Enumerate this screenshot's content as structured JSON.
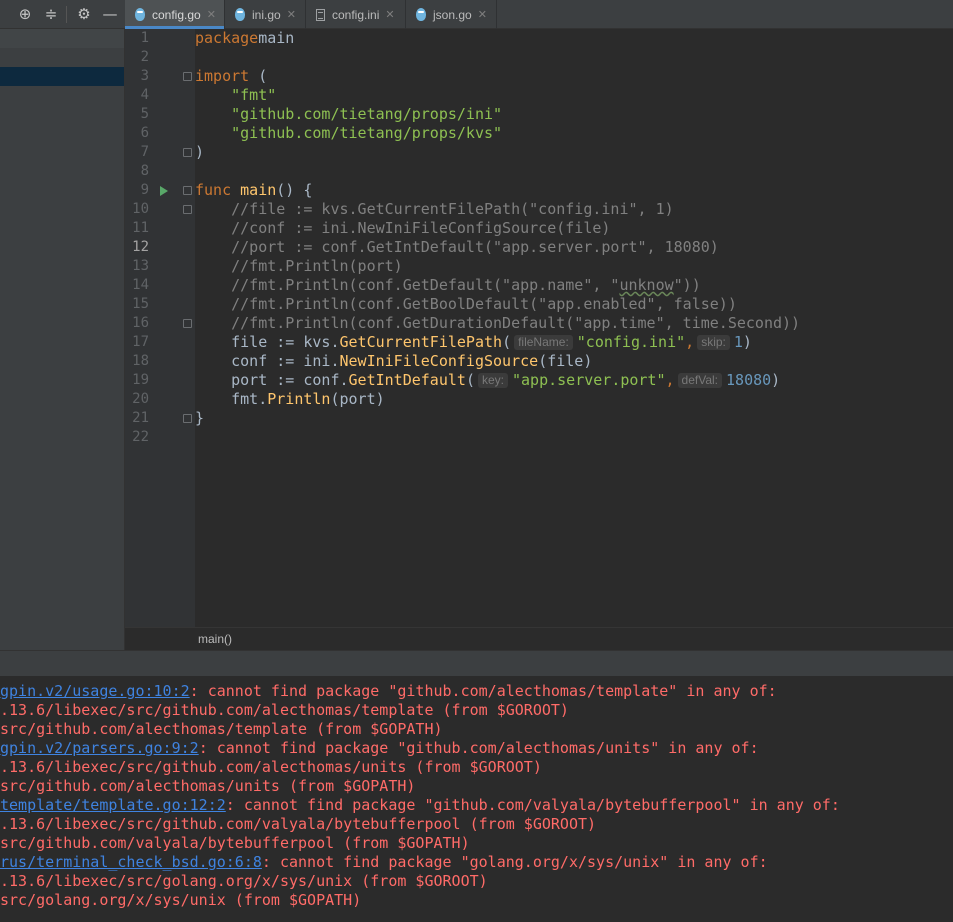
{
  "tabs": [
    {
      "label": "config.go",
      "icon": "go-file-icon",
      "active": true
    },
    {
      "label": "ini.go",
      "icon": "go-file-icon",
      "active": false
    },
    {
      "label": "config.ini",
      "icon": "ini-file-icon",
      "active": false
    },
    {
      "label": "json.go",
      "icon": "go-file-icon",
      "active": false
    }
  ],
  "toolbar": {
    "icons": [
      "crosshair-icon",
      "collapse-icon",
      "gear-icon",
      "minimize-icon"
    ]
  },
  "editor": {
    "current_line": 12,
    "lines": [
      {
        "n": "1",
        "parts": [
          [
            "kw",
            "package"
          ],
          [
            "",
            "main"
          ]
        ]
      },
      {
        "n": "2",
        "parts": []
      },
      {
        "n": "3",
        "parts": [
          [
            "kw",
            "import"
          ],
          [
            "",
            " ("
          ]
        ],
        "fold": true
      },
      {
        "n": "4",
        "parts": [
          [
            "",
            "    "
          ],
          [
            "str2",
            "\"fmt\""
          ]
        ]
      },
      {
        "n": "5",
        "parts": [
          [
            "",
            "    "
          ],
          [
            "str2",
            "\"github.com/tietang/props/ini\""
          ]
        ]
      },
      {
        "n": "6",
        "parts": [
          [
            "",
            "    "
          ],
          [
            "str2",
            "\"github.com/tietang/props/kvs\""
          ]
        ]
      },
      {
        "n": "7",
        "parts": [
          [
            "",
            ")"
          ]
        ],
        "fold": true
      },
      {
        "n": "8",
        "parts": []
      },
      {
        "n": "9",
        "parts": [
          [
            "kw",
            "func"
          ],
          [
            "",
            " "
          ],
          [
            "fn",
            "main"
          ],
          [
            "",
            "() {"
          ]
        ],
        "fold": true,
        "run": true
      },
      {
        "n": "10",
        "parts": [
          [
            "com",
            "    //file := kvs.GetCurrentFilePath(\"config.ini\", 1)"
          ]
        ],
        "fold": true
      },
      {
        "n": "11",
        "parts": [
          [
            "com",
            "    //conf := ini.NewIniFileConfigSource(file)"
          ]
        ]
      },
      {
        "n": "12",
        "parts": [
          [
            "com",
            "    //port := conf.GetIntDefault(\"app.server.port\", 18080)"
          ]
        ]
      },
      {
        "n": "13",
        "parts": [
          [
            "com",
            "    //fmt.Println(port)"
          ]
        ]
      },
      {
        "n": "14",
        "parts": [
          [
            "com",
            "    //fmt.Println(conf.GetDefault(\"app.name\", \""
          ],
          [
            "com squig",
            "unknow"
          ],
          [
            "com",
            "\"))"
          ]
        ]
      },
      {
        "n": "15",
        "parts": [
          [
            "com",
            "    //fmt.Println(conf.GetBoolDefault(\"app.enabled\", false))"
          ]
        ]
      },
      {
        "n": "16",
        "parts": [
          [
            "com",
            "    //fmt.Println(conf.GetDurationDefault(\"app.time\", time.Second))"
          ]
        ],
        "fold": true
      },
      {
        "n": "17",
        "parts": [
          [
            "",
            "    file := kvs."
          ],
          [
            "fn",
            "GetCurrentFilePath"
          ],
          [
            "",
            "("
          ],
          [
            "hint",
            "fileName:"
          ],
          [
            "str2",
            "\"config.ini\""
          ],
          [
            "kw",
            ","
          ],
          [
            "hint",
            "skip:"
          ],
          [
            "num",
            "1"
          ],
          [
            "",
            ")"
          ]
        ]
      },
      {
        "n": "18",
        "parts": [
          [
            "",
            "    conf := ini."
          ],
          [
            "fn",
            "NewIniFileConfigSource"
          ],
          [
            "",
            "(file)"
          ]
        ]
      },
      {
        "n": "19",
        "parts": [
          [
            "",
            "    port := conf."
          ],
          [
            "fn",
            "GetIntDefault"
          ],
          [
            "",
            "("
          ],
          [
            "hint",
            "key:"
          ],
          [
            "str2",
            "\"app.server.port\""
          ],
          [
            "kw",
            ","
          ],
          [
            "hint",
            "defVal:"
          ],
          [
            "num",
            "18080"
          ],
          [
            "",
            ")"
          ]
        ]
      },
      {
        "n": "20",
        "parts": [
          [
            "",
            "    fmt."
          ],
          [
            "fn",
            "Println"
          ],
          [
            "",
            "(port)"
          ]
        ]
      },
      {
        "n": "21",
        "parts": [
          [
            "",
            "}"
          ]
        ],
        "fold": true
      },
      {
        "n": "22",
        "parts": []
      }
    ]
  },
  "breadcrumb": {
    "label": "main()"
  },
  "console": {
    "lines": [
      {
        "link": "gpin.v2/usage.go:10:2",
        "text": ": cannot find package \"github.com/alecthomas/template\" in any of:"
      },
      {
        "text": ".13.6/libexec/src/github.com/alecthomas/template (from $GOROOT)"
      },
      {
        "text": "src/github.com/alecthomas/template (from $GOPATH)"
      },
      {
        "link": "gpin.v2/parsers.go:9:2",
        "text": ": cannot find package \"github.com/alecthomas/units\" in any of:"
      },
      {
        "text": ".13.6/libexec/src/github.com/alecthomas/units (from $GOROOT)"
      },
      {
        "text": "src/github.com/alecthomas/units (from $GOPATH)"
      },
      {
        "link": "template/template.go:12:2",
        "text": ": cannot find package \"github.com/valyala/bytebufferpool\" in any of:"
      },
      {
        "text": ".13.6/libexec/src/github.com/valyala/bytebufferpool (from $GOROOT)"
      },
      {
        "text": "src/github.com/valyala/bytebufferpool (from $GOPATH)"
      },
      {
        "link": "rus/terminal_check_bsd.go:6:8",
        "text": ": cannot find package \"golang.org/x/sys/unix\" in any of:"
      },
      {
        "text": ".13.6/libexec/src/golang.org/x/sys/unix (from $GOROOT)"
      },
      {
        "text": "src/golang.org/x/sys/unix (from $GOPATH)"
      }
    ]
  },
  "colors": {
    "keyword": "#cc7832",
    "function": "#ffc66d",
    "string": "#8ec052",
    "comment": "#808080",
    "number": "#6897bb",
    "error": "#ff6b68",
    "link": "#3f83e0",
    "active_tab_underline": "#4a88c7"
  }
}
